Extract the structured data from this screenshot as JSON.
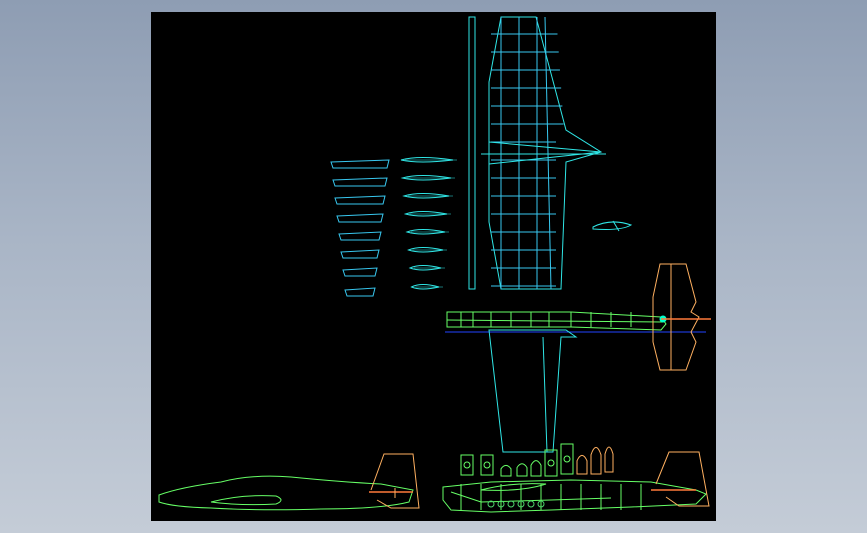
{
  "colors": {
    "background_gradient_top": "#8e9db3",
    "background_gradient_bottom": "#c4ccd7",
    "canvas": "#000000",
    "wing": "#2fe6e6",
    "wing_ribs": "#38c8f0",
    "fuselage": "#66ff66",
    "fuselage_detail": "#4ad46a",
    "tail": "#ffb060",
    "tail_stripe": "#ff7a3a",
    "outline_side": "#66ff66",
    "centerline": "#2244ff",
    "hub": "#00ffcc"
  },
  "icons": {
    "cad_drawing": "airplane-blueprint-icon"
  }
}
